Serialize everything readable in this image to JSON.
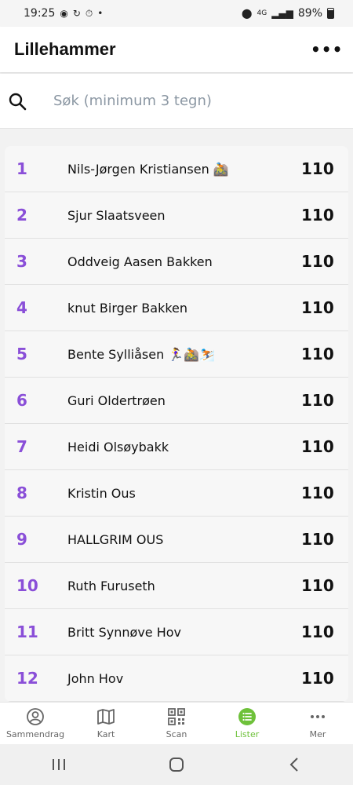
{
  "status_bar": {
    "time": "19:25",
    "battery": "89%",
    "network": "4G"
  },
  "header": {
    "title": "Lillehammer",
    "menu_label": "•••"
  },
  "search": {
    "placeholder": "Søk (minimum 3 tegn)"
  },
  "list": [
    {
      "rank": "1",
      "name": "Nils-Jørgen Kristiansen 🚵",
      "score": "110"
    },
    {
      "rank": "2",
      "name": "Sjur Slaatsveen",
      "score": "110"
    },
    {
      "rank": "3",
      "name": "Oddveig Aasen Bakken",
      "score": "110"
    },
    {
      "rank": "4",
      "name": "knut Birger Bakken",
      "score": "110"
    },
    {
      "rank": "5",
      "name": "Bente Sylliåsen 🏃‍♀️🚵⛷️",
      "score": "110"
    },
    {
      "rank": "6",
      "name": "Guri Oldertrøen",
      "score": "110"
    },
    {
      "rank": "7",
      "name": "Heidi Olsøybakk",
      "score": "110"
    },
    {
      "rank": "8",
      "name": "Kristin  Ous",
      "score": "110"
    },
    {
      "rank": "9",
      "name": "HALLGRIM OUS",
      "score": "110"
    },
    {
      "rank": "10",
      "name": "Ruth Furuseth",
      "score": "110"
    },
    {
      "rank": "11",
      "name": "Britt Synnøve Hov",
      "score": "110"
    },
    {
      "rank": "12",
      "name": "John Hov",
      "score": "110"
    }
  ],
  "bottom_nav": [
    {
      "label": "Sammendrag",
      "icon": "user-circle-icon"
    },
    {
      "label": "Kart",
      "icon": "map-icon"
    },
    {
      "label": "Scan",
      "icon": "qr-code-icon"
    },
    {
      "label": "Lister",
      "icon": "list-icon",
      "active": true
    },
    {
      "label": "Mer",
      "icon": "more-icon"
    }
  ],
  "colors": {
    "rank": "#8a4fd8",
    "active_tab": "#6ec13a",
    "placeholder": "#8b97a3"
  }
}
